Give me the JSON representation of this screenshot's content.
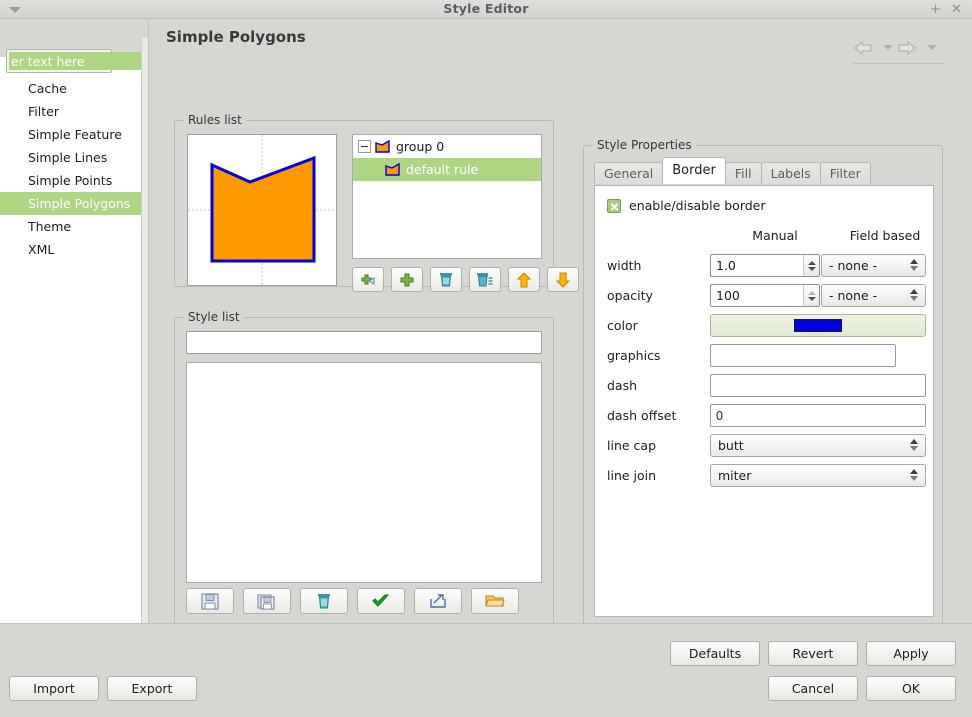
{
  "window": {
    "title": "Style Editor",
    "maximize_icon": "plus-icon",
    "close_icon": "close-icon",
    "corner_menu_icon": "caret-down-icon"
  },
  "sidebar": {
    "search": {
      "value": "er text here",
      "dropdown_icon": "caret-down-icon"
    },
    "items": [
      {
        "label": "Cache",
        "selected": false
      },
      {
        "label": "Filter",
        "selected": false
      },
      {
        "label": "Simple Feature",
        "selected": false
      },
      {
        "label": "Simple Lines",
        "selected": false
      },
      {
        "label": "Simple Points",
        "selected": false
      },
      {
        "label": "Simple Polygons",
        "selected": true
      },
      {
        "label": "Theme",
        "selected": false
      },
      {
        "label": "XML",
        "selected": false
      }
    ],
    "selected_color": "#aed581"
  },
  "content": {
    "page_title": "Simple Polygons",
    "nav": {
      "back_icon": "arrow-left-icon",
      "forward_icon": "arrow-right-icon"
    }
  },
  "rules_list": {
    "title": "Rules list",
    "preview": {
      "fill_color": "#FF9900",
      "stroke_color": "#0000DD",
      "guide_color": "#bfbfbf"
    },
    "tree": [
      {
        "label": "group 0",
        "type": "group",
        "expanded": true,
        "selected": false,
        "icon": "polygon-icon"
      },
      {
        "label": "default rule",
        "type": "rule",
        "selected": true,
        "icon": "polygon-icon"
      }
    ],
    "toolbar": [
      {
        "name": "add-rule-button",
        "icon": "add-rule-icon"
      },
      {
        "name": "add-group-button",
        "icon": "plus-icon"
      },
      {
        "name": "delete-rule-button",
        "icon": "trash-icon"
      },
      {
        "name": "delete-all-button",
        "icon": "trash-lines-icon"
      },
      {
        "name": "move-up-button",
        "icon": "arrow-up-icon"
      },
      {
        "name": "move-down-button",
        "icon": "arrow-down-icon"
      }
    ]
  },
  "style_list": {
    "title": "Style list",
    "name_field_value": "",
    "items": [],
    "toolbar": [
      {
        "name": "save-style-button",
        "icon": "floppy-icon"
      },
      {
        "name": "save-as-style-button",
        "icon": "copy-floppy-icon"
      },
      {
        "name": "delete-style-button",
        "icon": "trash-icon"
      },
      {
        "name": "validate-style-button",
        "icon": "checkmark-icon"
      },
      {
        "name": "export-style-button",
        "icon": "export-icon"
      },
      {
        "name": "open-style-button",
        "icon": "folder-open-icon"
      }
    ]
  },
  "style_properties": {
    "title": "Style Properties",
    "tabs": [
      {
        "label": "General",
        "active": false
      },
      {
        "label": "Border",
        "active": true
      },
      {
        "label": "Fill",
        "active": false
      },
      {
        "label": "Labels",
        "active": false
      },
      {
        "label": "Filter",
        "active": false
      }
    ],
    "enable_checkbox": {
      "label": "enable/disable border",
      "checked": true
    },
    "columns": {
      "manual": "Manual",
      "field_based": "Field based"
    },
    "fields": {
      "width": {
        "label": "width",
        "manual": "1.0",
        "field": "- none -"
      },
      "opacity": {
        "label": "opacity",
        "manual": "100",
        "field": "- none -"
      },
      "color": {
        "label": "color",
        "swatch": "#0000DD"
      },
      "graphics": {
        "label": "graphics",
        "value": "",
        "browse_label": "..."
      },
      "dash": {
        "label": "dash",
        "value": ""
      },
      "dash_offset": {
        "label": "dash offset",
        "value": "0"
      },
      "line_cap": {
        "label": "line cap",
        "value": "butt"
      },
      "line_join": {
        "label": "line join",
        "value": "miter"
      }
    }
  },
  "footer": {
    "defaults": "Defaults",
    "revert": "Revert",
    "apply": "Apply",
    "cancel": "Cancel",
    "ok": "OK",
    "import": "Import",
    "export": "Export"
  }
}
